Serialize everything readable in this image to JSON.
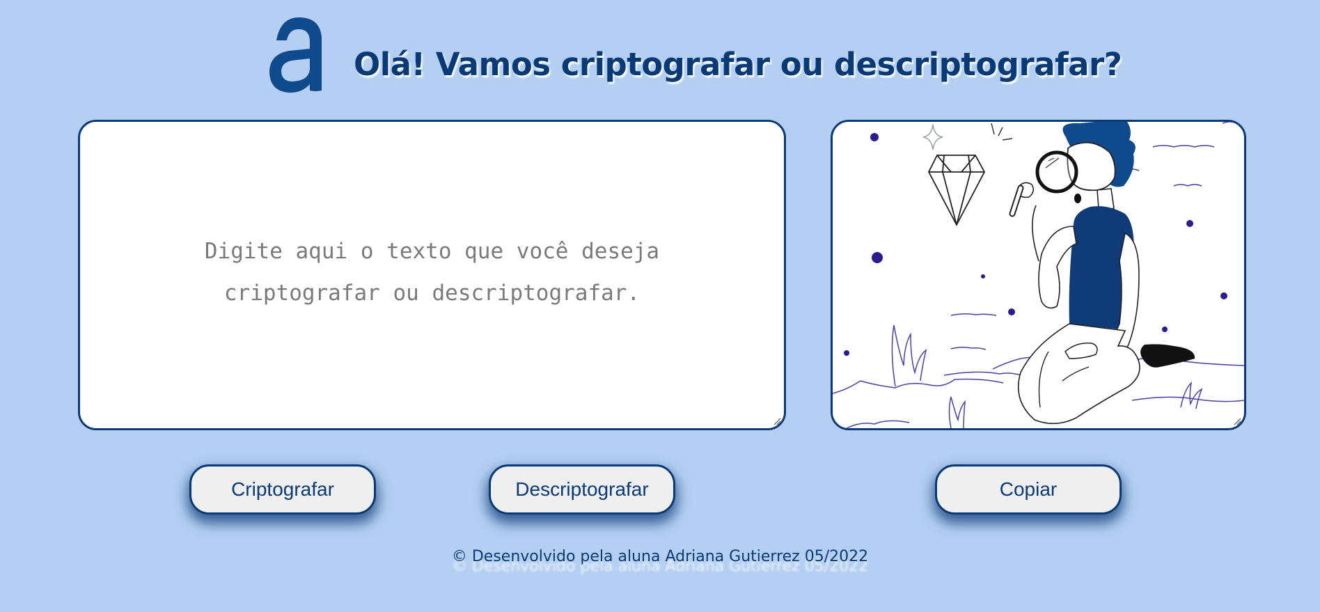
{
  "header": {
    "logo_icon": "letter-a-logo",
    "title": "Olá! Vamos criptografar ou descriptografar?"
  },
  "editor": {
    "placeholder": "Digite aqui o texto que você deseja criptografar ou descriptografar.",
    "value": ""
  },
  "illustration": {
    "icon": "person-with-magnifying-glass-and-diamond-illustration"
  },
  "buttons": {
    "encrypt_label": "Criptografar",
    "decrypt_label": "Descriptografar",
    "copy_label": "Copiar"
  },
  "footer": {
    "text": "© Desenvolvido pela aluna Adriana Gutierrez 05/2022"
  },
  "colors": {
    "background": "#b4cff2",
    "primary": "#0a3a75",
    "button_bg": "#efefef",
    "panel_bg": "#ffffff",
    "accent_dots": "#2d1a8c"
  }
}
